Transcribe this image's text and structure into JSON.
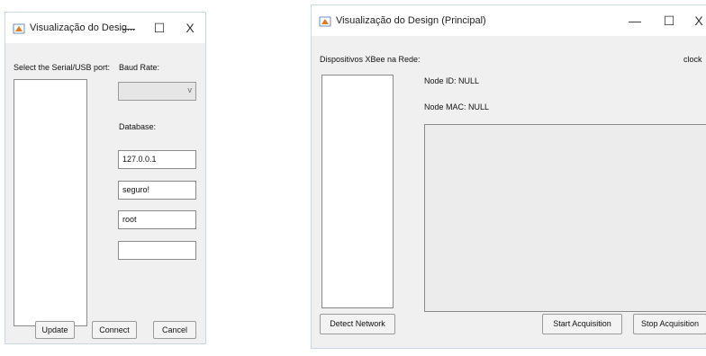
{
  "left_window": {
    "title": "Visualização do Desig...",
    "controls": {
      "minimize": "—",
      "maximize": "☐",
      "close": "X"
    },
    "serial_label": "Select the Serial/USB port:",
    "baud_label": "Baud Rate:",
    "baud_value": "",
    "database_label": "Database:",
    "fields": [
      "127.0.0.1",
      "seguro!",
      "root",
      ""
    ],
    "buttons": {
      "update": "Update",
      "connect": "Connect",
      "cancel": "Cancel"
    }
  },
  "right_window": {
    "title": "Visualização do Design (Principal)",
    "controls": {
      "minimize": "—",
      "maximize": "☐",
      "close": "X"
    },
    "devices_label": "Dispositivos XBee na Rede:",
    "clock_label": "clock",
    "node_id": "Node ID:  NULL",
    "node_mac": "Node MAC:  NULL",
    "buttons": {
      "detect": "Detect Network",
      "start": "Start Acquisition",
      "stop": "Stop Acquisition"
    }
  },
  "colors": {
    "window_bg": "#f0f0f0",
    "titlebar_bg": "#ffffff",
    "icon": "#e07b22"
  }
}
